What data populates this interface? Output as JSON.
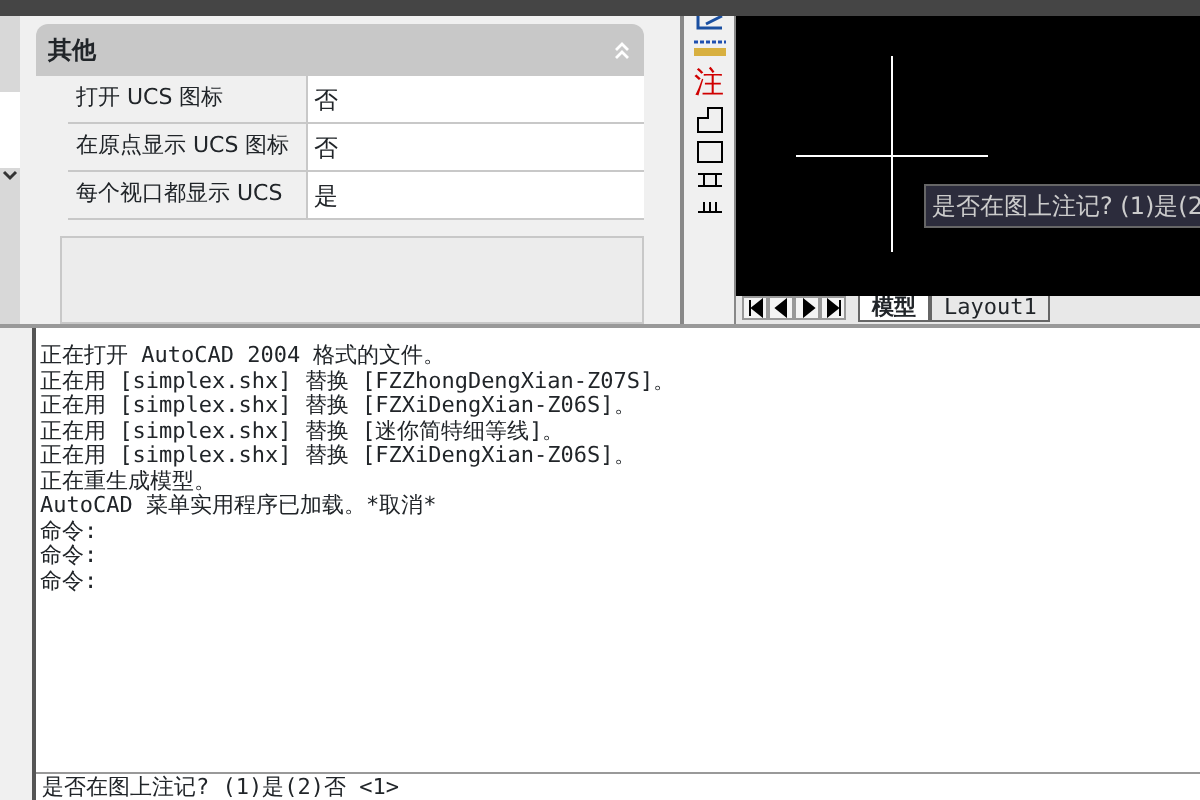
{
  "properties_panel": {
    "section_title": "其他",
    "rows": [
      {
        "name": "打开 UCS 图标",
        "value": "否"
      },
      {
        "name": "在原点显示 UCS 图标",
        "value": "否"
      },
      {
        "name": "每个视口都显示 UCS",
        "value": "是"
      }
    ]
  },
  "toolbar": {
    "annotation_label": "注"
  },
  "drawing_area": {
    "tooltip": "是否在图上注记? (1)是(2",
    "layout_tabs": [
      {
        "label": "模型",
        "selected": true
      },
      {
        "label": "Layout1",
        "selected": false
      }
    ]
  },
  "command_history": [
    "正在打开 AutoCAD 2004 格式的文件。",
    "正在用 [simplex.shx] 替换 [FZZhongDengXian-Z07S]。",
    "正在用 [simplex.shx] 替换 [FZXiDengXian-Z06S]。",
    "正在用 [simplex.shx] 替换 [迷你简特细等线]。",
    "正在用 [simplex.shx] 替换 [FZXiDengXian-Z06S]。",
    "正在重生成模型。",
    "AutoCAD 菜单实用程序已加载。*取消*",
    "命令:",
    "命令:",
    "命令:"
  ],
  "command_line": "是否在图上注记? (1)是(2)否 <1>"
}
